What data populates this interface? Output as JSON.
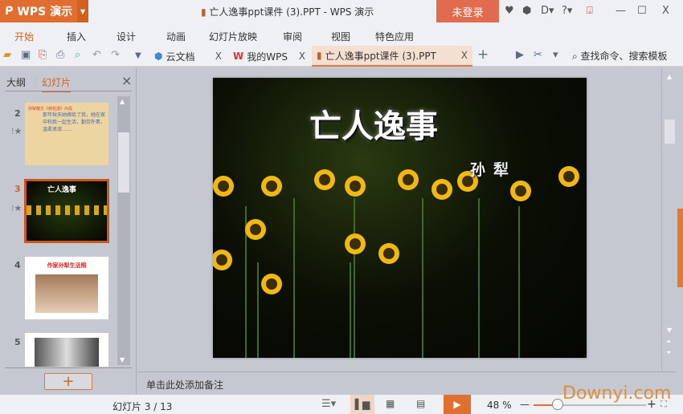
{
  "app": {
    "name": "WPS 演示",
    "title": "亡人逸事ppt课件 (3).PPT - WPS 演示",
    "login": "未登录"
  },
  "window_controls": {
    "help": "?",
    "minimize": "—",
    "maximize": "☐",
    "close": "X"
  },
  "menu": [
    "开始",
    "插入",
    "设计",
    "动画",
    "幻灯片放映",
    "审阅",
    "视图",
    "特色应用"
  ],
  "tabs": [
    {
      "label": "云文档"
    },
    {
      "label": "我的WPS"
    },
    {
      "label": "亡人逸事ppt课件 (3).PPT"
    }
  ],
  "tab_close": "X",
  "tab_add": "+",
  "search": {
    "placeholder": "查找命令、搜索模板"
  },
  "panel": {
    "tab_outline": "大纲",
    "tab_slides": "幻灯片",
    "close": "×",
    "add": "+"
  },
  "thumbs": [
    {
      "num": "2",
      "title": "孙犁散文《荷花淀》片段",
      "body": "那年秋天她嫁给了我，她在家中和我一起生活，勤劳朴素，温柔贤淑……"
    },
    {
      "num": "3",
      "title": "亡人逸事"
    },
    {
      "num": "4",
      "title": "作家孙犁生活照"
    },
    {
      "num": "5"
    }
  ],
  "slide": {
    "title": "亡人逸事",
    "author": "孙犁"
  },
  "notes": {
    "placeholder": "单击此处添加备注"
  },
  "status": {
    "slide_indicator": "幻灯片 3 / 13",
    "zoom": "48 %",
    "zoom_minus": "—",
    "zoom_plus": "+",
    "zoom_level_percent": 48
  },
  "watermark": "Downyi.com",
  "colors": {
    "accent": "#e26d30",
    "login": "#e06b4f"
  }
}
